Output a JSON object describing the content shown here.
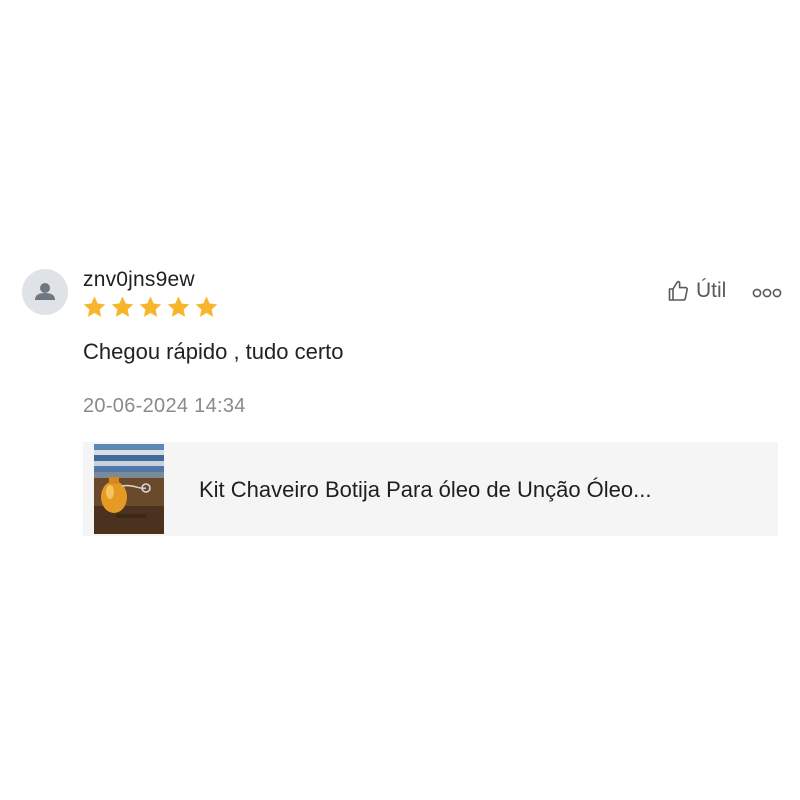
{
  "review": {
    "username": "znv0jns9ew",
    "rating": 5,
    "rating_max": 5,
    "comment": "Chegou rápido , tudo certo",
    "timestamp": "20-06-2024 14:34",
    "helpful_label": "Útil",
    "avatar_icon": "user-silhouette-icon",
    "helpful_icon": "thumbs-up-icon",
    "more_icon": "more-options-icon"
  },
  "product": {
    "title": "Kit Chaveiro Botija Para óleo de Unção Óleo..."
  },
  "colors": {
    "star": "#f7b52c",
    "card_background": "#f5f5f5",
    "secondary_text": "#8a8a8a"
  }
}
